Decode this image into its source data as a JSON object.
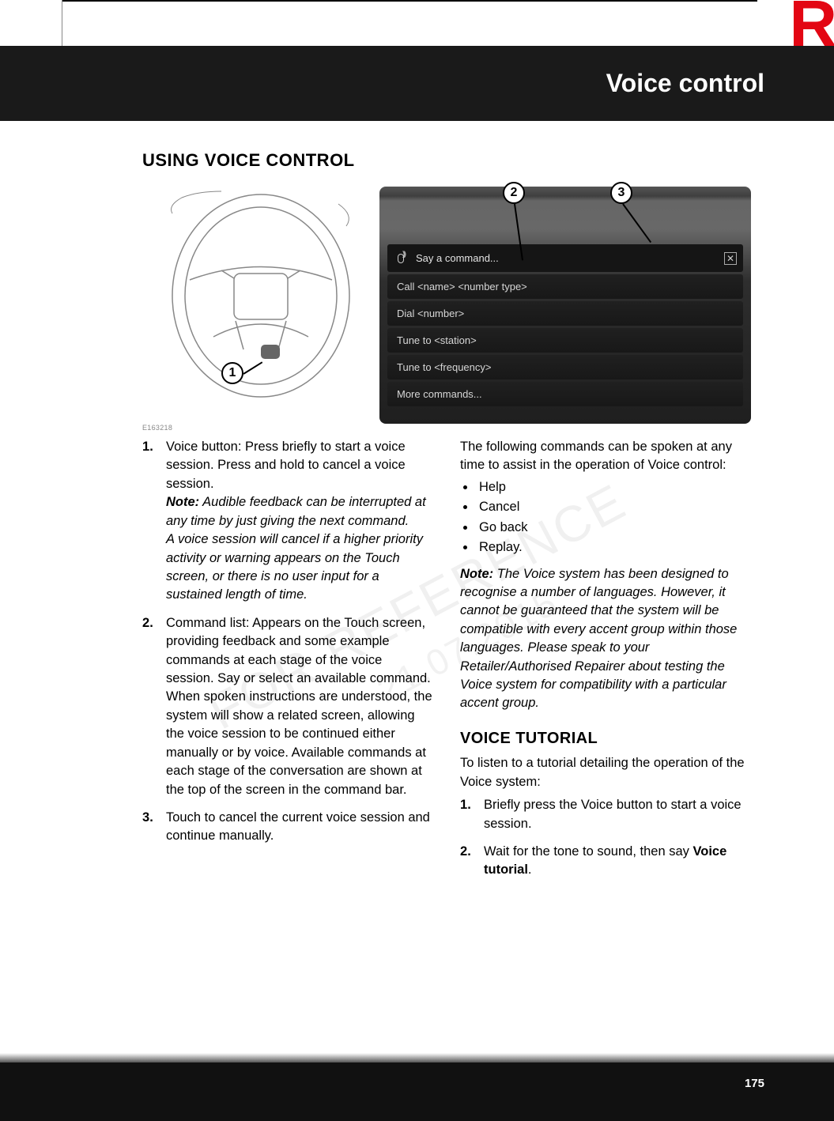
{
  "header": {
    "corner_letter": "R",
    "section_title": "Voice control"
  },
  "page": {
    "heading": "USING VOICE CONTROL",
    "figure_id": "E163218",
    "page_number": "175"
  },
  "callouts": {
    "c1": "1",
    "c2": "2",
    "c3": "3"
  },
  "screen": {
    "command_bar": "Say a command...",
    "rows": [
      "Call <name> <number type>",
      "Dial <number>",
      "Tune to <station>",
      "Tune to <frequency>",
      "More commands..."
    ]
  },
  "left_list": {
    "i1": {
      "main": "Voice button: Press briefly to start a voice session. Press and hold to cancel a voice session.",
      "note_lead": "Note:",
      "note_body": " Audible feedback can be interrupted at any time by just giving the next command.",
      "note_body2": "A voice session will cancel if a higher priority activity or warning appears on the Touch screen, or there is no user input for a sustained length of time."
    },
    "i2": {
      "main": "Command list: Appears on the Touch screen, providing feedback and some example commands at each stage of the voice session. Say or select an available command.",
      "para2": "When spoken instructions are understood, the system will show a related screen, allowing the voice session to be continued either manually or by voice. Available commands at each stage of the conversation are shown at the top of the screen in the command bar."
    },
    "i3": {
      "main": "Touch to cancel the current voice session and continue manually."
    }
  },
  "right": {
    "intro": "The following commands can be spoken at any time to assist in the operation of Voice control:",
    "bullets": [
      "Help",
      "Cancel",
      "Go back",
      "Replay."
    ],
    "note_lead": "Note:",
    "note_body": " The Voice system has been designed to recognise a number of languages. However, it cannot be guaranteed that the system will be compatible with every accent group within those languages. Please speak to your Retailer/Authorised Repairer about testing the Voice system for compatibility with a particular accent group.",
    "tutorial_heading": "VOICE TUTORIAL",
    "tutorial_intro": "To listen to a tutorial detailing the operation of the Voice system:",
    "t1": "Briefly press the Voice button to start a voice session.",
    "t2_a": "Wait for the tone to sound, then say ",
    "t2_b": "Voice tutorial",
    "t2_c": "."
  },
  "watermarks": {
    "w1": "FOR REFERENCE",
    "w2": "21.07.2015"
  }
}
